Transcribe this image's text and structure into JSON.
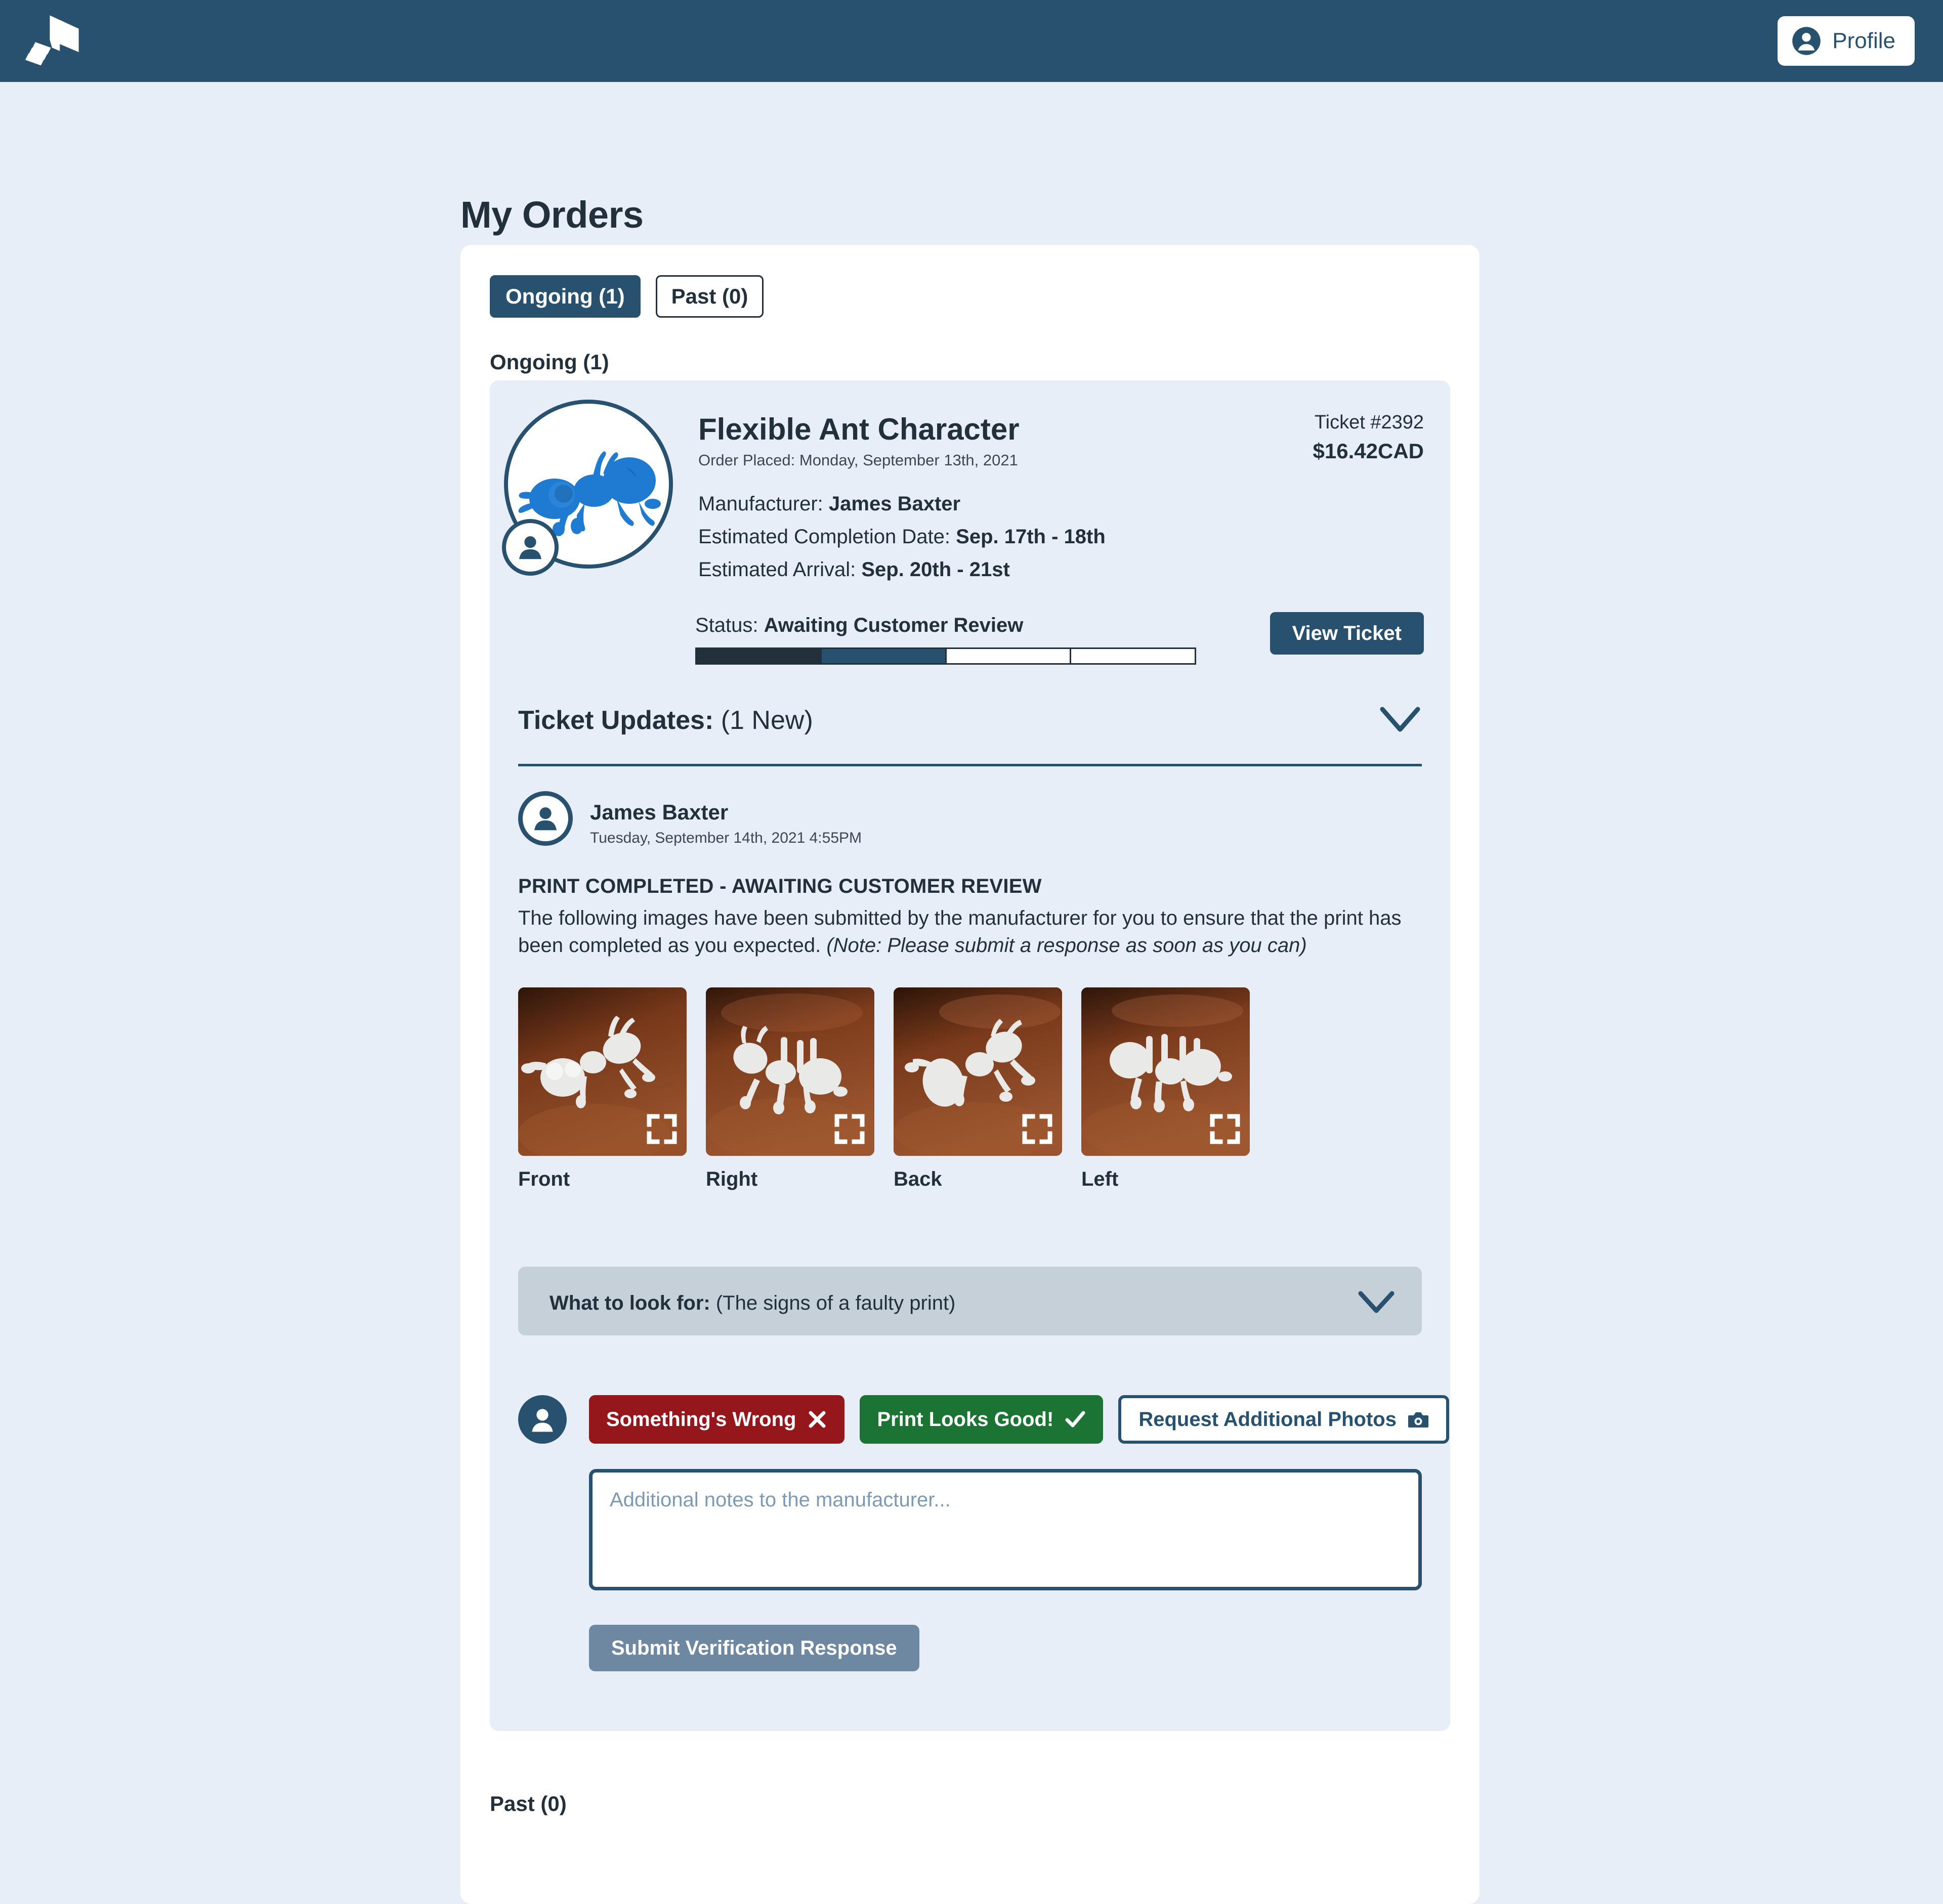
{
  "topbar": {
    "logo_icon": "3d-printer-logo",
    "profile_label": "Profile",
    "profile_icon": "account-circle-icon",
    "bar_color": "#27516f"
  },
  "page": {
    "title": "My Orders",
    "background_color": "#e8eef7",
    "card_color": "#ffffff"
  },
  "tabs": [
    {
      "label": "Ongoing (1)",
      "active": true
    },
    {
      "label": "Past (0)",
      "active": false
    }
  ],
  "sections": {
    "ongoing_heading": "Ongoing (1)",
    "past_heading": "Past (0)"
  },
  "order": {
    "panel_color": "#e8eef7",
    "model_thumb_icon": "blue-ant-3d-model",
    "model_badge_icon": "person-icon",
    "title": "Flexible Ant Character",
    "order_placed": "Order Placed: Monday, September 13th, 2021",
    "manufacturer_label": "Manufacturer:",
    "manufacturer_value": "James Baxter",
    "completion_label": "Estimated Completion Date:",
    "completion_value": "Sep. 17th - 18th",
    "arrival_label": "Estimated Arrival:",
    "arrival_value": "Sep. 20th - 21st",
    "ticket_number": "Ticket #2392",
    "price": "$16.42CAD",
    "status_label": "Status:",
    "status_value": "Awaiting Customer Review",
    "progress": {
      "total_steps": 4,
      "completed_steps": 1,
      "current_step": 2
    },
    "view_ticket_label": "View Ticket"
  },
  "updates": {
    "header_label": "Ticket Updates:",
    "header_count": "(1 New)",
    "collapse_icon": "chevron-down-icon",
    "entry": {
      "avatar_icon": "person-icon",
      "author": "James Baxter",
      "timestamp": "Tuesday, September 14th, 2021 4:55PM",
      "kicker": "PRINT COMPLETED - AWAITING CUSTOMER REVIEW",
      "body": "The following images have been submitted by the manufacturer for you to ensure that the print has been completed as you expected.",
      "body_note": "(Note: Please submit a response as soon as you can)"
    },
    "photos": [
      {
        "label": "Front",
        "expand_icon": "expand-icon"
      },
      {
        "label": "Right",
        "expand_icon": "expand-icon"
      },
      {
        "label": "Back",
        "expand_icon": "expand-icon"
      },
      {
        "label": "Left",
        "expand_icon": "expand-icon"
      }
    ],
    "look_for": {
      "label": "What to look for:",
      "hint": "(The signs of a faulty print)",
      "chevron_icon": "chevron-down-icon",
      "background_color": "#c6d0d9"
    },
    "response": {
      "avatar_icon": "person-filled-icon",
      "wrong_label": "Something's Wrong",
      "wrong_icon": "x-mark-icon",
      "wrong_color": "#96171b",
      "good_label": "Print Looks Good!",
      "good_icon": "check-mark-icon",
      "good_color": "#1b7434",
      "photos_label": "Request Additional Photos",
      "photos_icon": "camera-icon",
      "notes_placeholder": "Additional notes to the manufacturer...",
      "notes_value": "",
      "submit_label": "Submit Verification Response",
      "submit_color": "#6f88a2"
    }
  }
}
